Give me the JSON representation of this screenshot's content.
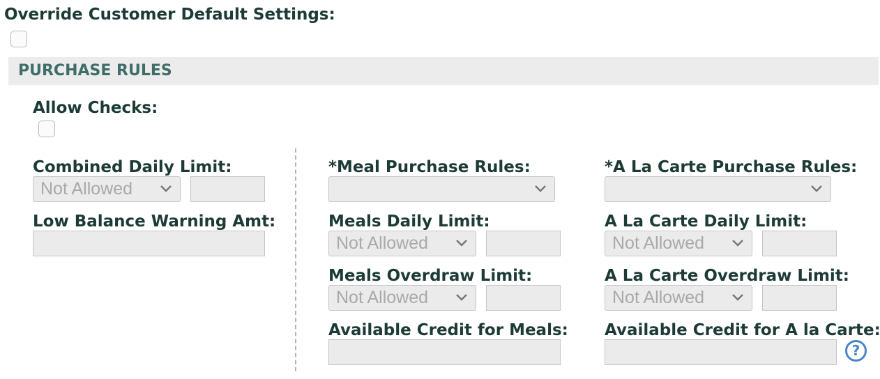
{
  "override": {
    "label": "Override Customer Default Settings:",
    "checked": false
  },
  "section": {
    "title": "PURCHASE RULES"
  },
  "allow_checks": {
    "label": "Allow Checks:",
    "checked": false
  },
  "left": {
    "combined_daily_limit": {
      "label": "Combined Daily Limit:",
      "select_value": "Not Allowed",
      "amount": ""
    },
    "low_balance_warning": {
      "label": "Low Balance Warning Amt:",
      "amount": ""
    }
  },
  "meals": {
    "purchase_rules": {
      "label": "*Meal Purchase Rules:",
      "select_value": ""
    },
    "daily_limit": {
      "label": "Meals Daily Limit:",
      "select_value": "Not Allowed",
      "amount": ""
    },
    "overdraw_limit": {
      "label": "Meals Overdraw Limit:",
      "select_value": "Not Allowed",
      "amount": ""
    },
    "available_credit": {
      "label": "Available Credit for Meals:",
      "amount": ""
    }
  },
  "alacarte": {
    "purchase_rules": {
      "label": "*A La Carte Purchase Rules:",
      "select_value": ""
    },
    "daily_limit": {
      "label": "A La Carte Daily Limit:",
      "select_value": "Not Allowed",
      "amount": ""
    },
    "overdraw_limit": {
      "label": "A La Carte Overdraw Limit:",
      "select_value": "Not Allowed",
      "amount": ""
    },
    "available_credit": {
      "label": "Available Credit for A la Carte:",
      "amount": ""
    }
  },
  "help": {
    "symbol": "?",
    "icon": "question-circle-icon",
    "color": "#4a86c6"
  },
  "colors": {
    "label": "#1d3b36",
    "section_title": "#3f6e68",
    "section_bg": "#ececec",
    "disabled_field": "#ebebeb"
  }
}
